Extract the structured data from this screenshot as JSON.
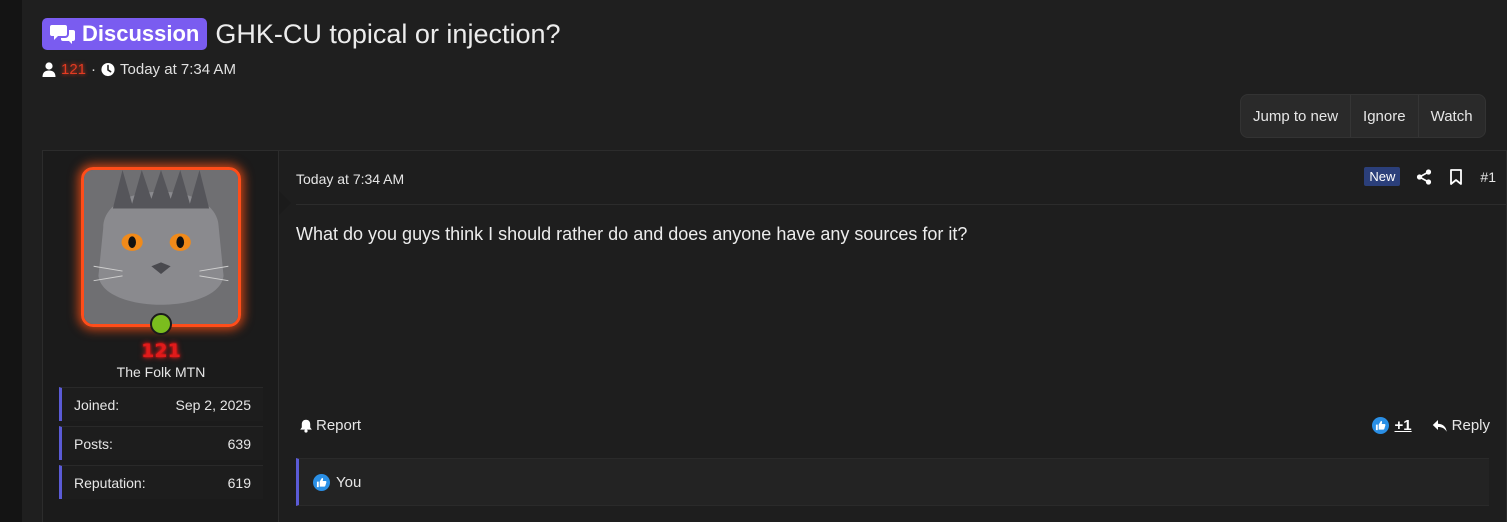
{
  "thread": {
    "prefix": "Discussion",
    "title": "GHK-CU topical or injection?",
    "author": "121",
    "separator": "·",
    "time": "Today at 7:34 AM"
  },
  "toolbar": {
    "jump_to_new": "Jump to new",
    "ignore": "Ignore",
    "watch": "Watch"
  },
  "user": {
    "name": "121",
    "title": "The Folk MTN",
    "stats": [
      {
        "label": "Joined:",
        "value": "Sep 2, 2025"
      },
      {
        "label": "Posts:",
        "value": "639"
      },
      {
        "label": "Reputation:",
        "value": "619"
      }
    ]
  },
  "post": {
    "date": "Today at 7:34 AM",
    "new_badge": "New",
    "number": "#1",
    "body": "What do you guys think I should rather do and does anyone have any sources for it?",
    "report": "Report",
    "like_count": "+1",
    "reply": "Reply",
    "reactions_text": "You"
  },
  "colors": {
    "prefix_bg": "#7a5cf0",
    "username": "#e01b1b",
    "accent_border": "#5b5bd6",
    "new_badge_bg": "#2b3f7a",
    "online": "#7bbd1e",
    "like": "#2a8fe5"
  },
  "icons": {
    "prefix": "chat-bubbles-icon",
    "author": "user-icon",
    "time": "clock-icon",
    "share": "share-icon",
    "bookmark": "bookmark-icon",
    "report": "bell-icon",
    "like": "thumbs-up-icon",
    "reply": "reply-icon"
  }
}
